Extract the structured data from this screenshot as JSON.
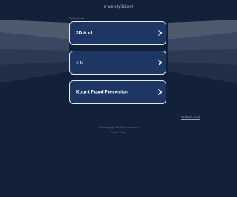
{
  "domain": "envelefy3d.net",
  "related_label": "Related Links",
  "cards": [
    {
      "label": "3D And"
    },
    {
      "label": "3 D"
    },
    {
      "label": "Kount Fraud Prevention"
    }
  ],
  "related_searches_link": "Related Links",
  "footer": {
    "copyright": "2024 Copyright. All Rights Reserved.",
    "privacy": "Privacy Policy"
  }
}
